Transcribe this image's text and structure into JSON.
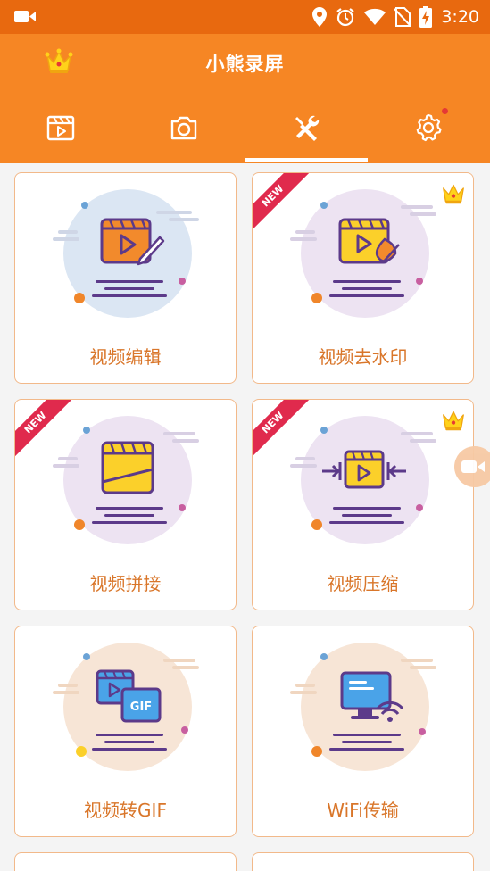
{
  "status_bar": {
    "time": "3:20"
  },
  "app": {
    "title": "小熊录屏"
  },
  "tabs": [
    {
      "name": "video-list"
    },
    {
      "name": "screenshot"
    },
    {
      "name": "tools",
      "active": true
    },
    {
      "name": "settings",
      "badge": true
    }
  ],
  "cards": [
    {
      "label": "视频编辑",
      "new": false,
      "vip": false
    },
    {
      "label": "视频去水印",
      "new": true,
      "vip": true
    },
    {
      "label": "视频拼接",
      "new": true,
      "vip": false
    },
    {
      "label": "视频压缩",
      "new": true,
      "vip": true
    },
    {
      "label": "视频转GIF",
      "new": false,
      "vip": false
    },
    {
      "label": "WiFi传输",
      "new": false,
      "vip": false
    }
  ],
  "badge_text": "NEW",
  "gif_text": "GIF",
  "colors": {
    "status_bar": "#e8690f",
    "header": "#f68624",
    "card_border": "#f2b98a",
    "label": "#d9762a",
    "ribbon": "#e02a4d"
  }
}
